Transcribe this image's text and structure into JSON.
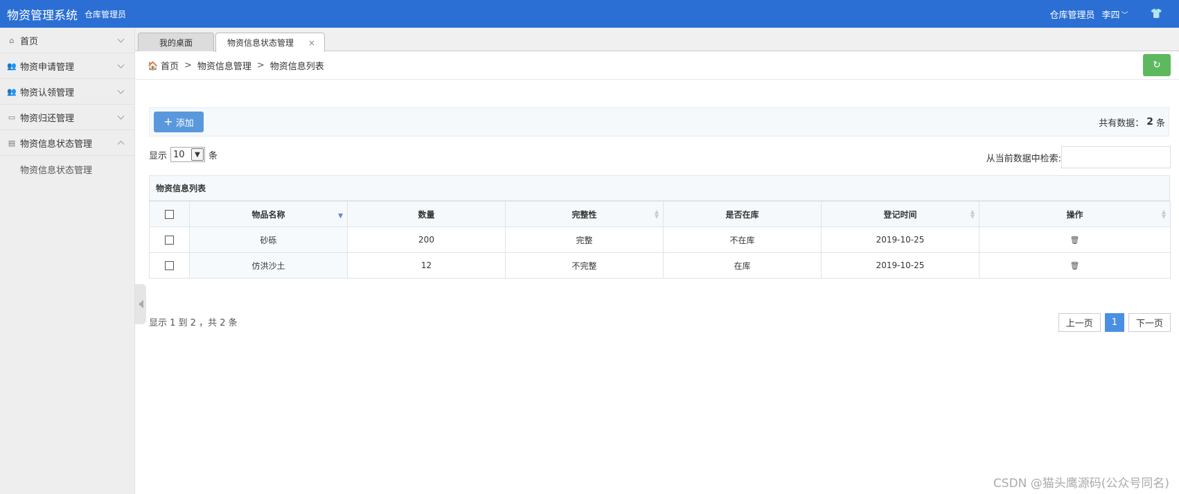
{
  "header": {
    "app_title": "物资管理系统",
    "role_subtitle": "仓库管理员",
    "role_label": "仓库管理员",
    "user_name": "李四",
    "shirt_icon": "tshirt-icon"
  },
  "sidebar": {
    "items": [
      {
        "label": "首页",
        "icon": "home-icon"
      },
      {
        "label": "物资申请管理",
        "icon": "users-icon"
      },
      {
        "label": "物资认领管理",
        "icon": "users-icon"
      },
      {
        "label": "物资归还管理",
        "icon": "table-icon"
      },
      {
        "label": "物资信息状态管理",
        "icon": "clipboard-icon"
      }
    ],
    "submenu": [
      "物资信息状态管理"
    ]
  },
  "tabs": [
    {
      "label": "我的桌面"
    },
    {
      "label": "物资信息状态管理",
      "close": "×"
    }
  ],
  "breadcrumb": {
    "home": "首页",
    "sep": ">",
    "level1": "物资信息管理",
    "level2": "物资信息列表"
  },
  "toolbar": {
    "add_label": "添加",
    "total_prefix": "共有数据：",
    "total_count": "2",
    "total_suffix": "条"
  },
  "length_control": {
    "prefix": "显示",
    "value": "10",
    "suffix": "条"
  },
  "search": {
    "label": "从当前数据中检索:",
    "value": ""
  },
  "table": {
    "caption": "物资信息列表",
    "columns": [
      "物品名称",
      "数量",
      "完整性",
      "是否在库",
      "登记时间",
      "操作"
    ],
    "rows": [
      {
        "name": "砂砾",
        "qty": "200",
        "integrity": "完整",
        "in_stock": "不在库",
        "date": "2019-10-25"
      },
      {
        "name": "仿洪沙土",
        "qty": "12",
        "integrity": "不完整",
        "in_stock": "在库",
        "date": "2019-10-25"
      }
    ]
  },
  "info": "显示 1 到 2 ，共 2 条",
  "pager": {
    "prev": "上一页",
    "current": "1",
    "next": "下一页"
  },
  "watermark": "CSDN @猫头鹰源码(公众号同名)",
  "colors": {
    "header_bg": "#2b6fd4",
    "add_button": "#5a98de",
    "refresh_button": "#5eb95e",
    "active_page": "#4a90e2"
  }
}
